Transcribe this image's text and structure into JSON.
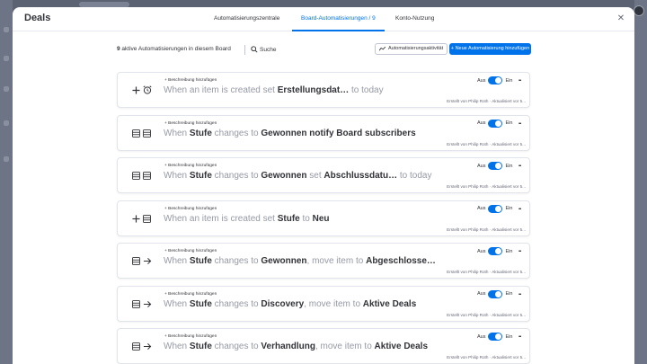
{
  "modal": {
    "title": "Deals",
    "close_symbol": "✕",
    "tabs": [
      {
        "label": "Automatisierungszentrale",
        "active": false
      },
      {
        "label": "Board-Automatisierungen / 9",
        "active": true
      },
      {
        "label": "Konto-Nutzung",
        "active": false
      }
    ]
  },
  "toolbar": {
    "count": "9",
    "count_suffix": " aktive Automatisierungen in diesem Board",
    "search_label": "Suche",
    "activity_label": "Automatisierungsaktivität",
    "new_label": "+ Neue Automatisierung hinzufügen"
  },
  "colors": {
    "accent": "#0073ea",
    "muted_text": "#9699a6",
    "text": "#323338"
  },
  "automations": [
    {
      "add_description": "+ Beschreibung hinzufügen",
      "icons": [
        "plus-icon",
        "alarm-clock-icon"
      ],
      "parts": [
        {
          "text": "When an item is created set ",
          "kw": false
        },
        {
          "text": "Erstellungsdat…",
          "kw": true
        },
        {
          "text": "  to today",
          "kw": false
        }
      ],
      "toggle_off": "Aus",
      "toggle_on": "Ein",
      "meta": "Erstellt von Philip Roth · Aktualisiert vor 5..."
    },
    {
      "add_description": "+ Beschreibung hinzufügen",
      "icons": [
        "board-icon",
        "board-icon"
      ],
      "parts": [
        {
          "text": "When ",
          "kw": false
        },
        {
          "text": "Stufe",
          "kw": true
        },
        {
          "text": " changes to ",
          "kw": false
        },
        {
          "text": "Gewonnen",
          "kw": true
        },
        {
          "text": " notify ",
          "kw": true
        },
        {
          "text": "Board subscribers",
          "kw": true
        }
      ],
      "toggle_off": "Aus",
      "toggle_on": "Ein",
      "meta": "Erstellt von Philip Roth · Aktualisiert vor 5..."
    },
    {
      "add_description": "+ Beschreibung hinzufügen",
      "icons": [
        "board-icon",
        "board-icon"
      ],
      "parts": [
        {
          "text": "When ",
          "kw": false
        },
        {
          "text": "Stufe",
          "kw": true
        },
        {
          "text": " changes to ",
          "kw": false
        },
        {
          "text": "Gewonnen",
          "kw": true
        },
        {
          "text": " set ",
          "kw": false
        },
        {
          "text": "Abschlussdatu…",
          "kw": true
        },
        {
          "text": "  to today",
          "kw": false
        }
      ],
      "toggle_off": "Aus",
      "toggle_on": "Ein",
      "meta": "Erstellt von Philip Roth · Aktualisiert vor 5..."
    },
    {
      "add_description": "+ Beschreibung hinzufügen",
      "icons": [
        "plus-icon",
        "board-icon"
      ],
      "parts": [
        {
          "text": "When an item is created set ",
          "kw": false
        },
        {
          "text": "Stufe",
          "kw": true
        },
        {
          "text": " to ",
          "kw": false
        },
        {
          "text": "Neu",
          "kw": true
        }
      ],
      "toggle_off": "Aus",
      "toggle_on": "Ein",
      "meta": "Erstellt von Philip Roth · Aktualisiert vor 5..."
    },
    {
      "add_description": "+ Beschreibung hinzufügen",
      "icons": [
        "board-icon",
        "arrow-right-icon"
      ],
      "parts": [
        {
          "text": "When ",
          "kw": false
        },
        {
          "text": "Stufe",
          "kw": true
        },
        {
          "text": " changes to ",
          "kw": false
        },
        {
          "text": "Gewonnen",
          "kw": true
        },
        {
          "text": ", move item to ",
          "kw": false
        },
        {
          "text": "Abgeschlosse…",
          "kw": true
        }
      ],
      "toggle_off": "Aus",
      "toggle_on": "Ein",
      "meta": "Erstellt von Philip Roth · Aktualisiert vor 5..."
    },
    {
      "add_description": "+ Beschreibung hinzufügen",
      "icons": [
        "board-icon",
        "arrow-right-icon"
      ],
      "parts": [
        {
          "text": "When ",
          "kw": false
        },
        {
          "text": "Stufe",
          "kw": true
        },
        {
          "text": " changes to ",
          "kw": false
        },
        {
          "text": "Discovery",
          "kw": true
        },
        {
          "text": ", move item to ",
          "kw": false
        },
        {
          "text": "Aktive Deals",
          "kw": true
        }
      ],
      "toggle_off": "Aus",
      "toggle_on": "Ein",
      "meta": "Erstellt von Philip Roth · Aktualisiert vor 5..."
    },
    {
      "add_description": "+ Beschreibung hinzufügen",
      "icons": [
        "board-icon",
        "arrow-right-icon"
      ],
      "parts": [
        {
          "text": "When ",
          "kw": false
        },
        {
          "text": "Stufe",
          "kw": true
        },
        {
          "text": " changes to ",
          "kw": false
        },
        {
          "text": "Verhandlung",
          "kw": true
        },
        {
          "text": ", move item to ",
          "kw": false
        },
        {
          "text": "Aktive Deals",
          "kw": true
        }
      ],
      "toggle_off": "Aus",
      "toggle_on": "Ein",
      "meta": "Erstellt von Philip Roth · Aktualisiert vor 5..."
    }
  ]
}
